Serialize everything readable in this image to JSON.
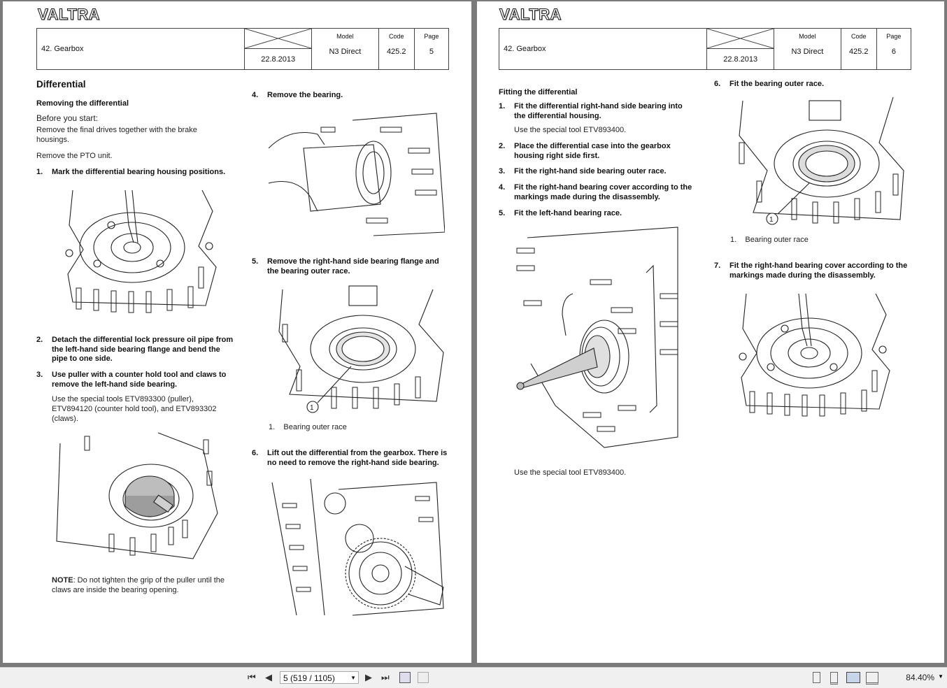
{
  "brand": "VALTRA",
  "page_left": {
    "header": {
      "section": "42. Gearbox",
      "date": "22.8.2013",
      "model_label": "Model",
      "model": "N3 Direct",
      "code_label": "Code",
      "code": "425.2",
      "page_label": "Page",
      "page": "5"
    },
    "title": "Differential",
    "subtitle": "Removing the differential",
    "before_start": "Before you start:",
    "prep1": "Remove the final drives together with the brake housings.",
    "prep2": "Remove the PTO unit.",
    "steps": [
      {
        "n": "1.",
        "text": "Mark the differential bearing housing positions."
      },
      {
        "n": "2.",
        "text": "Detach the differential lock pressure oil pipe from the left-hand side bearing flange and bend the pipe to one side."
      },
      {
        "n": "3.",
        "text": "Use puller with a counter hold tool and claws to remove the left-hand side bearing."
      },
      {
        "n": "4.",
        "text": "Remove the bearing."
      },
      {
        "n": "5.",
        "text": "Remove the right-hand side bearing flange and the bearing outer race."
      },
      {
        "n": "6.",
        "text": "Lift out the differential from the gearbox. There is no need to remove the right-hand side bearing."
      }
    ],
    "step3_note": "Use the special tools ETV893300 (puller), ETV894120 (counter hold tool), and ETV893302 (claws).",
    "note_label": "NOTE",
    "note_text": ": Do not tighten the grip of the puller until the claws are inside the bearing opening.",
    "fig5_callout": "1",
    "fig5_caption_n": "1.",
    "fig5_caption": "Bearing outer race"
  },
  "page_right": {
    "header": {
      "section": "42. Gearbox",
      "date": "22.8.2013",
      "model_label": "Model",
      "model": "N3 Direct",
      "code_label": "Code",
      "code": "425.2",
      "page_label": "Page",
      "page": "6"
    },
    "subtitle": "Fitting the differential",
    "steps": [
      {
        "n": "1.",
        "text": "Fit the differential right-hand side bearing into the differential housing."
      },
      {
        "n": "2.",
        "text": "Place the differential case into the gearbox housing right side first."
      },
      {
        "n": "3.",
        "text": "Fit the right-hand side bearing outer race."
      },
      {
        "n": "4.",
        "text": "Fit the right-hand bearing cover according to the markings made during the disassembly."
      },
      {
        "n": "5.",
        "text": "Fit the left-hand bearing race."
      },
      {
        "n": "6.",
        "text": "Fit the bearing outer race."
      },
      {
        "n": "7.",
        "text": "Fit the right-hand bearing cover according to the markings made during the disassembly."
      }
    ],
    "step1_note": "Use the special tool ETV893400.",
    "step5_note": "Use the special tool ETV893400.",
    "fig6_callout": "1",
    "fig6_caption_n": "1.",
    "fig6_caption": "Bearing outer race"
  },
  "toolbar": {
    "page_field": "5 (519 / 1105)",
    "zoom": "84.40%",
    "icons": [
      "first-page-icon",
      "prev-page-icon",
      "next-page-icon",
      "last-page-icon",
      "fit-page-icon",
      "fit-width-icon",
      "single-page-view-icon",
      "continuous-view-icon",
      "two-page-view-icon",
      "two-page-continuous-view-icon"
    ]
  }
}
